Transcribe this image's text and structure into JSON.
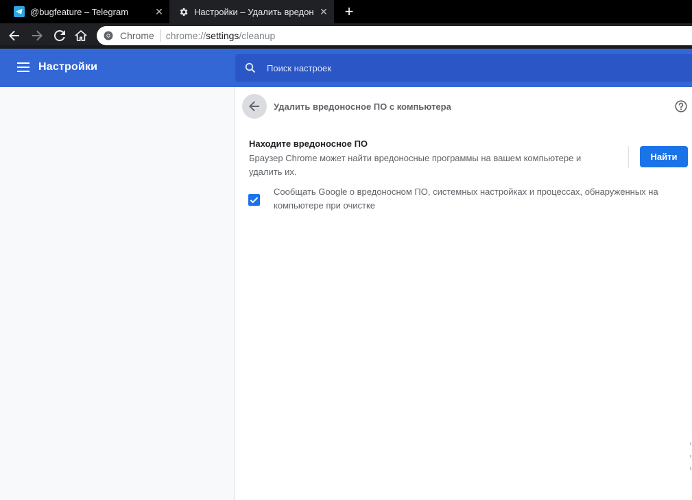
{
  "tabs": [
    {
      "title": "@bugfeature – Telegram",
      "icon": "telegram-icon",
      "active": false
    },
    {
      "title": "Настройки – Удалить вредоносное ПО с компьютера",
      "icon": "gear-icon",
      "active": true
    }
  ],
  "new_tab_label": "+",
  "tab_close_glyph": "✕",
  "omnibox": {
    "scheme_label": "Chrome",
    "url_prefix": "chrome://",
    "url_host": "settings",
    "url_path": "/cleanup"
  },
  "header": {
    "title": "Настройки",
    "search_placeholder": "Поиск настроек"
  },
  "page": {
    "title": "Удалить вредоносное ПО с компьютера",
    "section_title": "Находите вредоносное ПО",
    "section_desc": "Браузер Chrome может найти вредоносные программы на вашем компьютере и удалить их.",
    "find_button": "Найти",
    "report_checkbox_label": "Сообщать Google о вредоносном ПО, системных настройках и процессах, обнаруженных на компьютере при очистке",
    "report_checked": true
  },
  "colors": {
    "header": "#3367d6",
    "search": "#2a56c6",
    "accent": "#1a73e8",
    "tabstrip": "#000000",
    "toolbar": "#202124"
  }
}
